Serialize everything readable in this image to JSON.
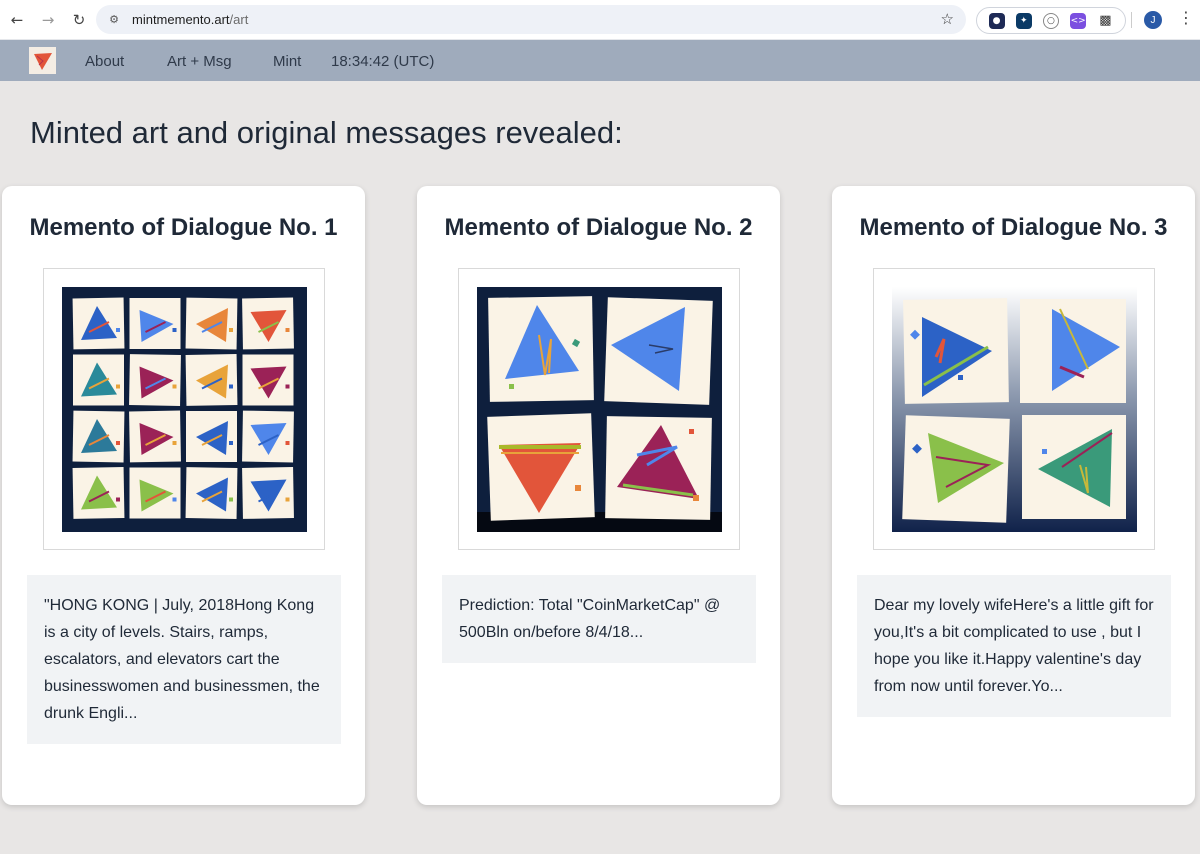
{
  "browser": {
    "url_host": "mintmemento.art",
    "url_path": "/art",
    "avatar_letter": "J"
  },
  "nav": {
    "about": "About",
    "art_msg": "Art + Msg",
    "mint": "Mint",
    "clock": "18:34:42 (UTC)"
  },
  "page": {
    "title": "Minted art and original messages revealed:"
  },
  "cards": [
    {
      "title": "Memento of Dialogue No. 1",
      "message": "\"HONG KONG | July, 2018Hong Kong is a city of levels. Stairs, ramps, escalators, and elevators cart the businesswomen and businessmen, the drunk Engli..."
    },
    {
      "title": "Memento of Dialogue No. 2",
      "message": "Prediction: Total \"CoinMarketCap\" @ 500Bln on/before 8/4/18..."
    },
    {
      "title": "Memento of Dialogue No. 3",
      "message": "Dear my lovely wifeHere's a little gift for you,It's a bit complicated to use , but I hope you like it.Happy valentine's day from now until forever.Yo..."
    }
  ],
  "colors": {
    "nav_bg": "#9fabbc",
    "page_bg": "#e8e6e5",
    "art_navy": "#0e1f3d",
    "tile_cream": "#faf3e6"
  },
  "icons": {
    "back": "arrow-left-icon",
    "forward": "arrow-right-icon",
    "reload": "reload-icon",
    "site_settings": "tune-icon",
    "bookmark": "star-icon",
    "extensions": "puzzle-icon",
    "menu": "more-vert-icon"
  }
}
